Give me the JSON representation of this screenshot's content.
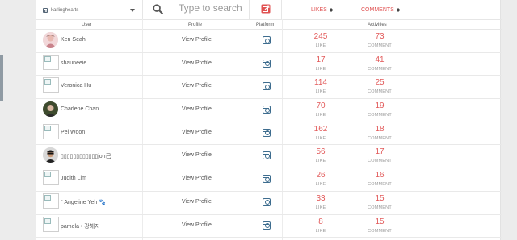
{
  "toolbar": {
    "account_name": "karlinghearts",
    "search_placeholder": "Type to search",
    "sort_likes_label": "LIKES",
    "sort_comments_label": "COMMENTS"
  },
  "columns": {
    "user": "User",
    "profile": "Profile",
    "platform": "Platform",
    "activities": "Activities"
  },
  "rows": [
    {
      "name": "Ken Seah",
      "profile_link": "View Profile",
      "likes": "245",
      "likes_label": "LIKE",
      "comments": "73",
      "comments_label": "COMMENT",
      "avatar": "photo"
    },
    {
      "name": "shauneeie",
      "profile_link": "View Profile",
      "likes": "17",
      "likes_label": "LIKE",
      "comments": "41",
      "comments_label": "COMMENT",
      "avatar": "broken"
    },
    {
      "name": "Veronica Hu",
      "profile_link": "View Profile",
      "likes": "114",
      "likes_label": "LIKE",
      "comments": "25",
      "comments_label": "COMMENT",
      "avatar": "broken"
    },
    {
      "name": "Charlene Chan",
      "profile_link": "View Profile",
      "likes": "70",
      "likes_label": "LIKE",
      "comments": "19",
      "comments_label": "COMMENT",
      "avatar": "photo"
    },
    {
      "name": "Pei Woon",
      "profile_link": "View Profile",
      "likes": "162",
      "likes_label": "LIKE",
      "comments": "18",
      "comments_label": "COMMENT",
      "avatar": "broken"
    },
    {
      "name": "▯▯▯▯▯▯▯▯▯▯▯▯jon己",
      "profile_link": "View Profile",
      "likes": "56",
      "likes_label": "LIKE",
      "comments": "17",
      "comments_label": "COMMENT",
      "avatar": "photo"
    },
    {
      "name": "Judith Lim",
      "profile_link": "View Profile",
      "likes": "26",
      "likes_label": "LIKE",
      "comments": "16",
      "comments_label": "COMMENT",
      "avatar": "broken"
    },
    {
      "name": "° Angeline Yeh 🐾",
      "profile_link": "View Profile",
      "likes": "33",
      "likes_label": "LIKE",
      "comments": "15",
      "comments_label": "COMMENT",
      "avatar": "broken"
    },
    {
      "name": "pamela • 강해지",
      "profile_link": "View Profile",
      "likes": "8",
      "likes_label": "LIKE",
      "comments": "15",
      "comments_label": "COMMENT",
      "avatar": "broken"
    }
  ],
  "icons": {
    "search": "search-icon",
    "export": "export-icon",
    "platform": "instagram-icon"
  },
  "colors": {
    "accent": "#e05252",
    "instagram": "#3d6c8e"
  }
}
